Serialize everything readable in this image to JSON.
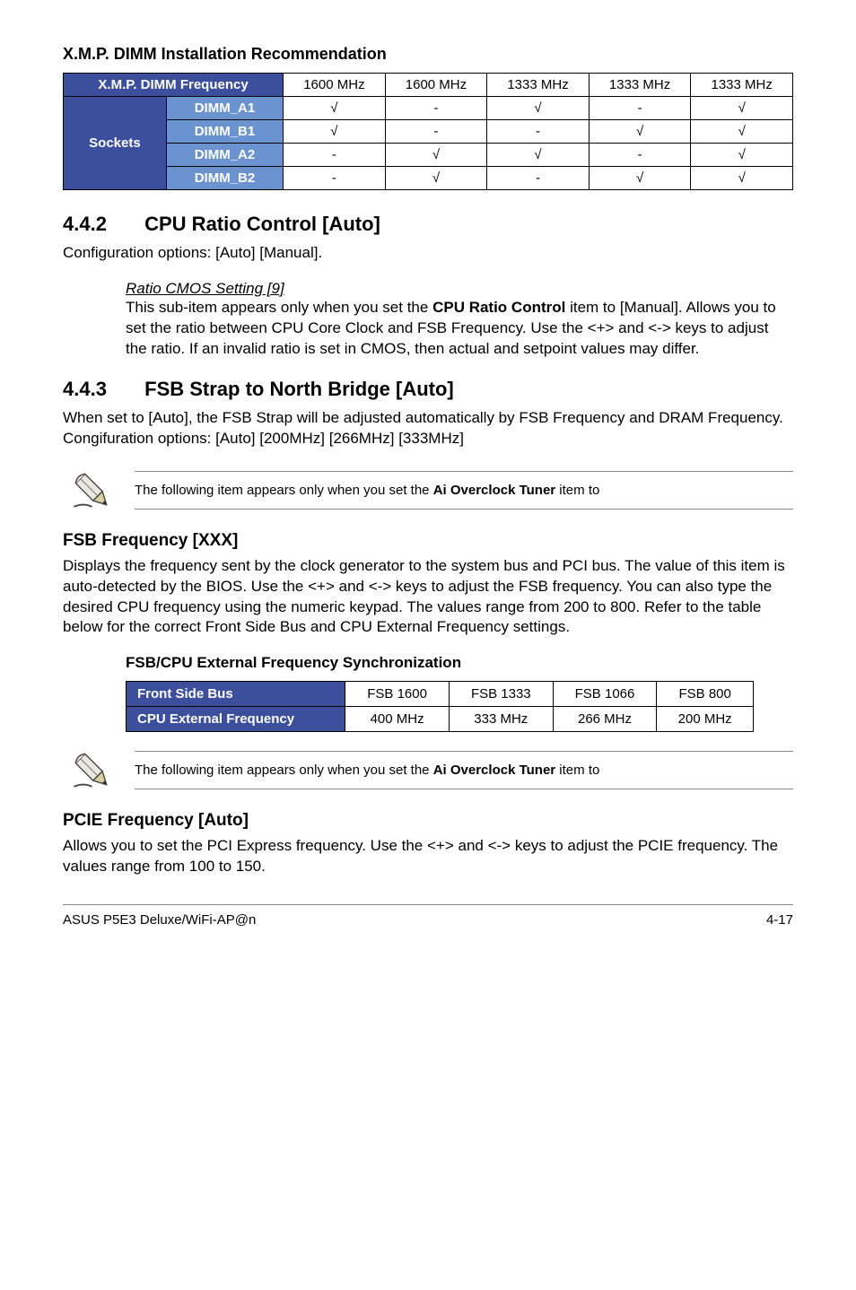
{
  "xmp": {
    "title": "X.M.P. DIMM Installation Recommendation",
    "freq_label": "X.M.P. DIMM Frequency",
    "sockets_label": "Sockets",
    "headers": [
      "1600 MHz",
      "1600 MHz",
      "1333 MHz",
      "1333 MHz",
      "1333 MHz"
    ],
    "rows": [
      {
        "label": "DIMM_A1",
        "cells": [
          "√",
          "-",
          "√",
          "-",
          "√"
        ]
      },
      {
        "label": "DIMM_B1",
        "cells": [
          "√",
          "-",
          "-",
          "√",
          "√"
        ]
      },
      {
        "label": "DIMM_A2",
        "cells": [
          "-",
          "√",
          "√",
          "-",
          "√"
        ]
      },
      {
        "label": "DIMM_B2",
        "cells": [
          "-",
          "√",
          "-",
          "√",
          "√"
        ]
      }
    ]
  },
  "sec_442": {
    "num": "4.4.2",
    "title": "CPU Ratio Control [Auto]",
    "body": "Configuration options: [Auto] [Manual].",
    "subhead": "Ratio CMOS Setting [9]",
    "subtext1": "This sub-item appears only when you set the ",
    "subbold": "CPU Ratio Control",
    "subtext2": " item to [Manual]. Allows you to set the ratio between CPU Core Clock and FSB Frequency. Use the <+> and <-> keys to adjust the ratio. If an invalid ratio is set in CMOS, then actual and setpoint values may differ."
  },
  "sec_443": {
    "num": "4.4.3",
    "title": "FSB Strap to North Bridge [Auto]",
    "body1": "When set to [Auto], the FSB Strap will be adjusted automatically by FSB Frequency and DRAM Frequency.",
    "body2": "Congifuration options: [Auto] [200MHz] [266MHz] [333MHz]"
  },
  "note1_pre": "The following item appears only when you set the ",
  "note1_bold": "Ai Overclock Tuner",
  "note1_post": " item to",
  "fsb_section": {
    "title": "FSB Frequency [XXX]",
    "body": "Displays the frequency sent by the clock generator to the system bus and PCI bus. The value of this item is auto-detected by the BIOS. Use the <+> and <-> keys to adjust the FSB frequency. You can also type the desired CPU frequency using the numeric keypad. The values range from 200 to 800. Refer to the table below for the correct Front Side Bus and CPU External Frequency settings.",
    "table_title": "FSB/CPU External Frequency Synchronization",
    "row1_label": "Front Side Bus",
    "row1": [
      "FSB 1600",
      "FSB 1333",
      "FSB 1066",
      "FSB 800"
    ],
    "row2_label": "CPU External Frequency",
    "row2": [
      "400 MHz",
      "333 MHz",
      "266 MHz",
      "200 MHz"
    ]
  },
  "note2_pre": "The following item appears only when you set the ",
  "note2_bold": "Ai Overclock Tuner",
  "note2_post": " item to",
  "pcie": {
    "title": "PCIE Frequency [Auto]",
    "body": "Allows you to set the PCI Express frequency. Use the <+> and <-> keys to adjust the PCIE frequency. The values range from 100 to 150."
  },
  "footer": {
    "left": "ASUS P5E3 Deluxe/WiFi-AP@n",
    "right": "4-17"
  }
}
